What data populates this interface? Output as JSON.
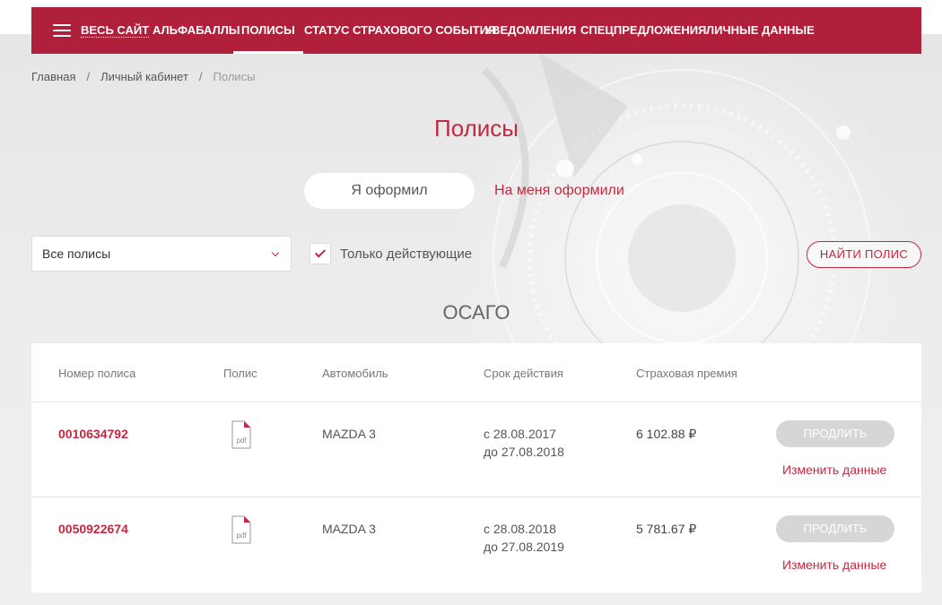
{
  "nav": {
    "items": [
      {
        "label": "ВЕСЬ САЙТ"
      },
      {
        "label": "АЛЬФАБАЛЛЫ"
      },
      {
        "label": "ПОЛИСЫ"
      },
      {
        "label": "СТАТУС СТРАХОВОГО СОБЫТИЯ"
      },
      {
        "label": "УВЕДОМЛЕНИЯ"
      },
      {
        "label": "СПЕЦПРЕДЛОЖЕНИЯ"
      },
      {
        "label": "ЛИЧНЫЕ ДАННЫЕ"
      }
    ],
    "active_item": "ПОЛИСЫ"
  },
  "breadcrumb": [
    "Главная",
    "Личный кабинет",
    "Полисы"
  ],
  "page_title": "Полисы",
  "tabs": [
    "Я оформил",
    "На меня оформили"
  ],
  "filters": {
    "select_value": "Все полисы",
    "only_active_label": "Только действующие",
    "only_active_checked": true,
    "find_button": "НАЙТИ ПОЛИС"
  },
  "section_title": "ОСАГО",
  "table": {
    "headers": [
      "Номер полиса",
      "Полис",
      "Автомобиль",
      "Срок действия",
      "Страховая премия"
    ],
    "rows": [
      {
        "number": "0010634792",
        "pdf_label": "pdf",
        "car": "MAZDA 3",
        "period_from": "с 28.08.2017",
        "period_to": "до 27.08.2018",
        "premium": "6 102.88 ₽",
        "renew_button": "ПРОДЛИТЬ",
        "change_link": "Изменить данные"
      },
      {
        "number": "0050922674",
        "pdf_label": "pdf",
        "car": "MAZDA 3",
        "period_from": "с 28.08.2018",
        "period_to": "до 27.08.2019",
        "premium": "5 781.67 ₽",
        "renew_button": "ПРОДЛИТЬ",
        "change_link": "Изменить данные"
      }
    ]
  },
  "colors": {
    "brand": "#b0203a",
    "accent": "#c42840",
    "disabled_button": "#d6d6d6"
  }
}
